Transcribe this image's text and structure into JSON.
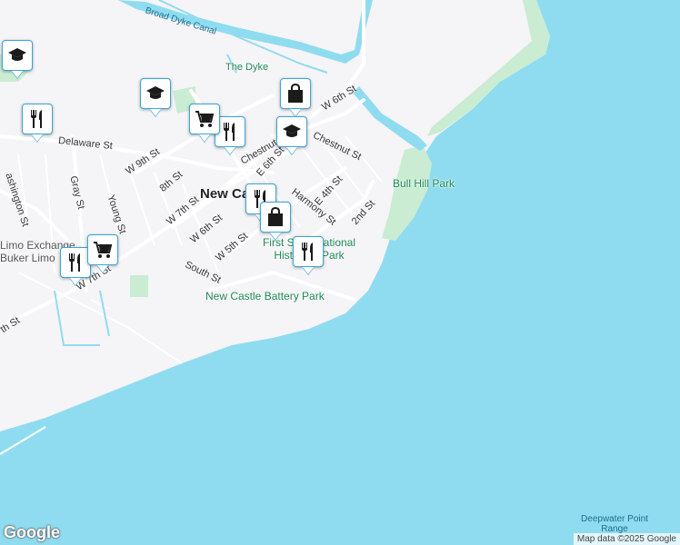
{
  "map": {
    "labels": {
      "broad_dyke_canal": "Broad Dyke Canal",
      "the_dyke": "The Dyke",
      "bull_hill_park": "Bull Hill Park",
      "delaware_st": "Delaware St",
      "w_6th_st_north": "W 6th St",
      "chestnut_st_west": "Chestnut St",
      "chestnut_st_east": "Chestnut St",
      "e_6th_st": "E 6th St",
      "e_4th_st": "E 4th St",
      "second_st": "2nd St",
      "harmony_st": "Harmony St",
      "w_9th_st": "W 9th St",
      "eighth_st": "8th St",
      "w_7th_st": "W 7th St",
      "w_6th_st": "W 6th St",
      "w_5th_st": "W 5th St",
      "south_st": "South St",
      "gray_st": "Gray St",
      "young_st": "Young St",
      "washington_st": "ashington St",
      "w_7th_st_south": "W 7th St",
      "th_st_edge": "th St",
      "new_castle": "New Castle",
      "first_state_park": "First State National Historical Park",
      "battery_park": "New Castle Battery Park",
      "limo_exchange": "Limo Exchange",
      "buker_limo": "Buker Limo",
      "deepwater": "Deepwater Point Range"
    },
    "pins": [
      {
        "icon": "school-icon"
      },
      {
        "icon": "school-icon"
      },
      {
        "icon": "school-icon"
      },
      {
        "icon": "restaurant-icon"
      },
      {
        "icon": "restaurant-icon"
      },
      {
        "icon": "restaurant-icon"
      },
      {
        "icon": "restaurant-icon"
      },
      {
        "icon": "restaurant-icon"
      },
      {
        "icon": "shopping-bag-icon"
      },
      {
        "icon": "shopping-bag-icon"
      },
      {
        "icon": "shopping-cart-icon"
      },
      {
        "icon": "shopping-cart-icon"
      }
    ],
    "colors": {
      "water": "#8fdcf0",
      "land": "#f5f4f6",
      "park": "#c9ecd2",
      "road": "#ffffff",
      "pin_border": "#3aa6d8"
    },
    "logo": "Google",
    "attribution": "Map data ©2025 Google"
  }
}
